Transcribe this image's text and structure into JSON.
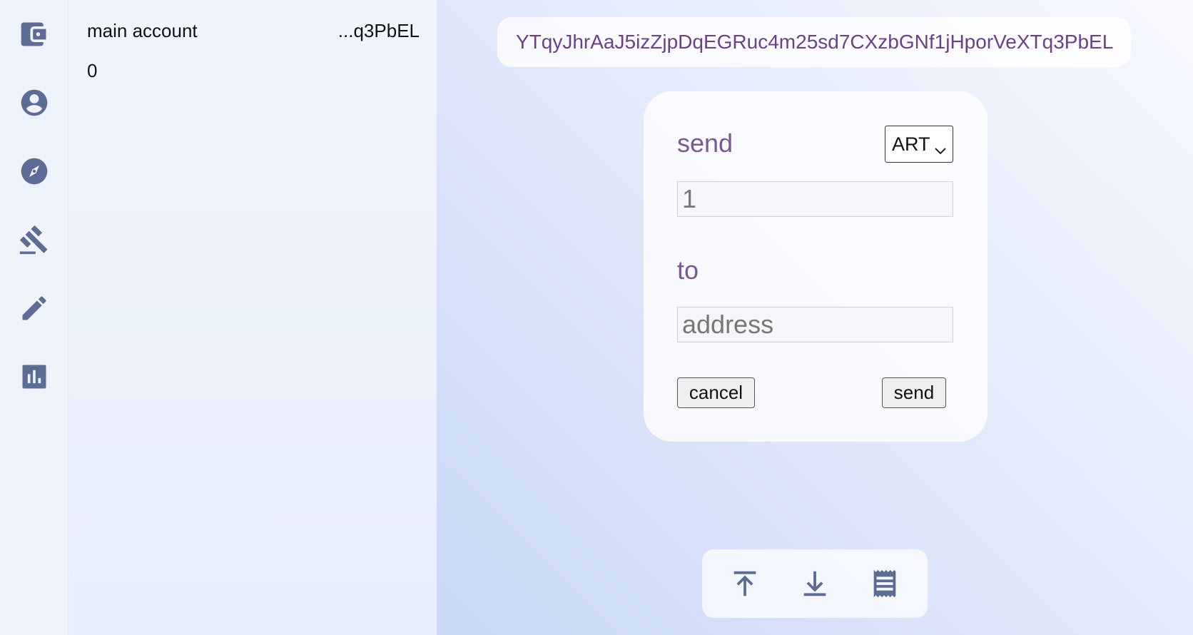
{
  "sidebar": {
    "items": [
      {
        "name": "wallet-icon"
      },
      {
        "name": "account-circle-icon"
      },
      {
        "name": "compass-icon"
      },
      {
        "name": "gavel-icon"
      },
      {
        "name": "pencil-icon"
      },
      {
        "name": "bar-chart-icon"
      }
    ]
  },
  "account": {
    "name": "main account",
    "address_short": "...q3PbEL",
    "balance": "0"
  },
  "header": {
    "full_address": "YTqyJhrAaJ5izZjpDqEGRuc4m25sd7CXzbGNf1jHporVeXTq3PbEL"
  },
  "send_form": {
    "title": "send",
    "asset": "ART",
    "amount_value": "1",
    "to_label": "to",
    "address_placeholder": "address",
    "cancel_label": "cancel",
    "send_label": "send"
  },
  "actions": [
    {
      "name": "upload-icon"
    },
    {
      "name": "download-icon"
    },
    {
      "name": "receipt-icon"
    }
  ],
  "colors": {
    "icon": "#5b6d94",
    "accent_text": "#7a5796",
    "address_text": "#6e3f8b"
  }
}
